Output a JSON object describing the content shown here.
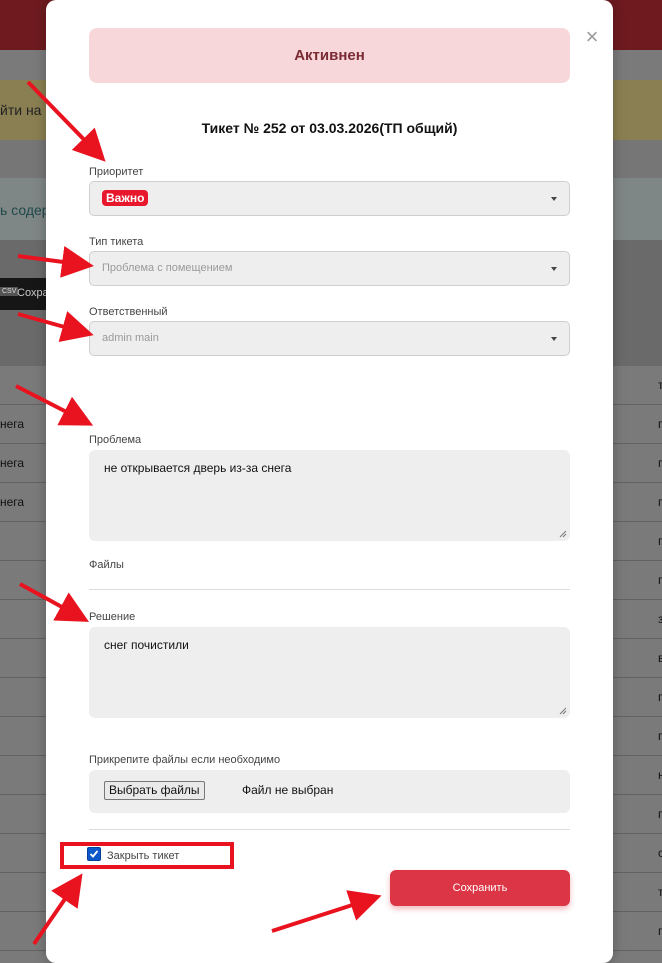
{
  "background": {
    "yellow_text": "йти на С",
    "blue_text": "ь содер",
    "save_button": {
      "csv_label": "CSV",
      "label": "Сохра"
    },
    "rows_left": [
      "",
      "нега",
      "нега",
      "нега",
      "",
      "",
      "",
      "",
      "",
      "",
      "",
      "",
      "",
      "",
      ""
    ],
    "rows_right": [
      "т",
      "п",
      "п",
      "п",
      "п",
      "п",
      "з",
      "в",
      "п",
      "п",
      "н",
      "п",
      "с",
      "т",
      "п"
    ]
  },
  "modal": {
    "status": "Активнен",
    "ticket_title": "Тикет № 252 от 03.03.2026(ТП общий)",
    "priority": {
      "label": "Приоритет",
      "value": "Важно",
      "badge_color": "#e8172b"
    },
    "ticket_type": {
      "label": "Тип тикета",
      "value": "Проблема с помещением"
    },
    "responsible": {
      "label": "Ответственный",
      "value": "admin main"
    },
    "problem": {
      "label": "Проблема",
      "value": "не открывается дверь из-за снега"
    },
    "files_label": "Файлы",
    "solution": {
      "label": "Решение",
      "value": "снег почистили"
    },
    "attach": {
      "label": "Прикрепите файлы если необходимо",
      "button": "Выбрать файлы",
      "status": "Файл не выбран"
    },
    "close_ticket": {
      "label": "Закрыть тикет",
      "checked": true
    },
    "save_button": "Сохранить",
    "close_icon": "close-icon"
  },
  "colors": {
    "accent": "#dc3545",
    "status_bg": "#f7d7da",
    "annotation": "#e8131f"
  }
}
